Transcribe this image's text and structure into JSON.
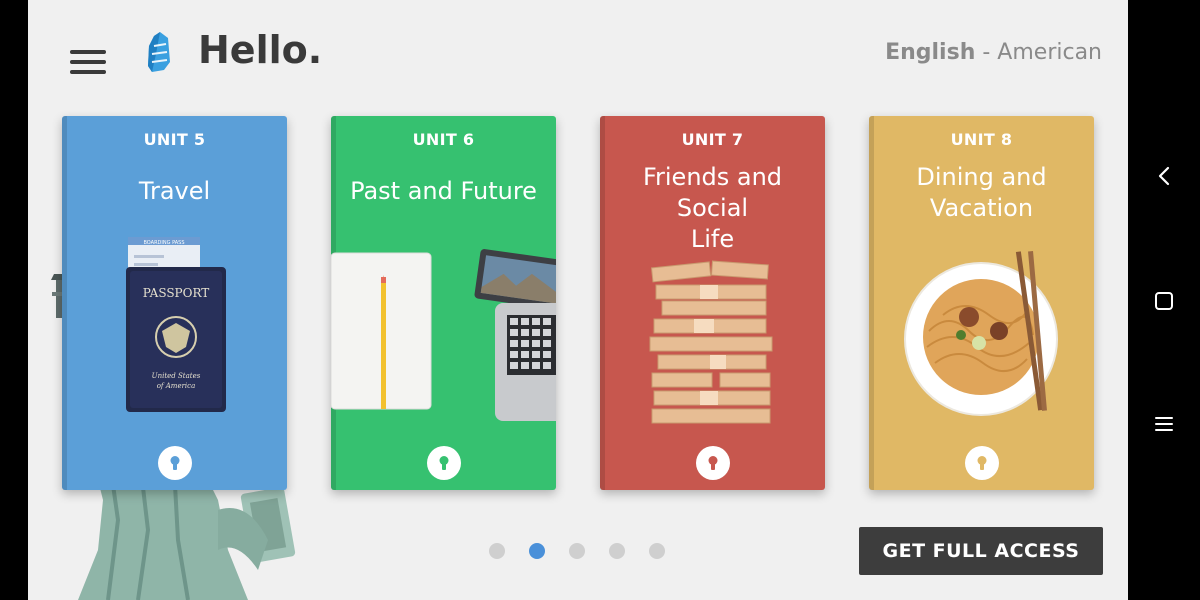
{
  "header": {
    "greeting": "Hello.",
    "language_name": "English",
    "language_separator": " - ",
    "language_variant": "American"
  },
  "icons": {
    "menu": "hamburger-menu-icon",
    "logo": "rosetta-stone-logo",
    "lock": "lock-icon",
    "back": "chevron-left-icon",
    "home": "square-home-icon",
    "recents": "recents-menu-icon"
  },
  "units": [
    {
      "unit": "UNIT 5",
      "title_lines": [
        "Travel"
      ],
      "color": "#5b9fd8"
    },
    {
      "unit": "UNIT 6",
      "title_lines": [
        "Past and Future"
      ],
      "color": "#36c170"
    },
    {
      "unit": "UNIT 7",
      "title_lines": [
        "Friends and Social",
        "Life"
      ],
      "color": "#c7574e"
    },
    {
      "unit": "UNIT 8",
      "title_lines": [
        "Dining and",
        "Vacation"
      ],
      "color": "#e0b865"
    }
  ],
  "art_text": {
    "boarding_pass": "BOARDING PASS",
    "passport_title": "PASSPORT",
    "passport_sub_1": "United States",
    "passport_sub_2": "of America"
  },
  "pagination": {
    "count": 5,
    "active_index": 1
  },
  "cta": {
    "label": "GET FULL ACCESS"
  },
  "colors": {
    "accent": "#4a90d9",
    "text_dark": "#3a3a3a",
    "cta_bg": "#3d3d3d"
  }
}
